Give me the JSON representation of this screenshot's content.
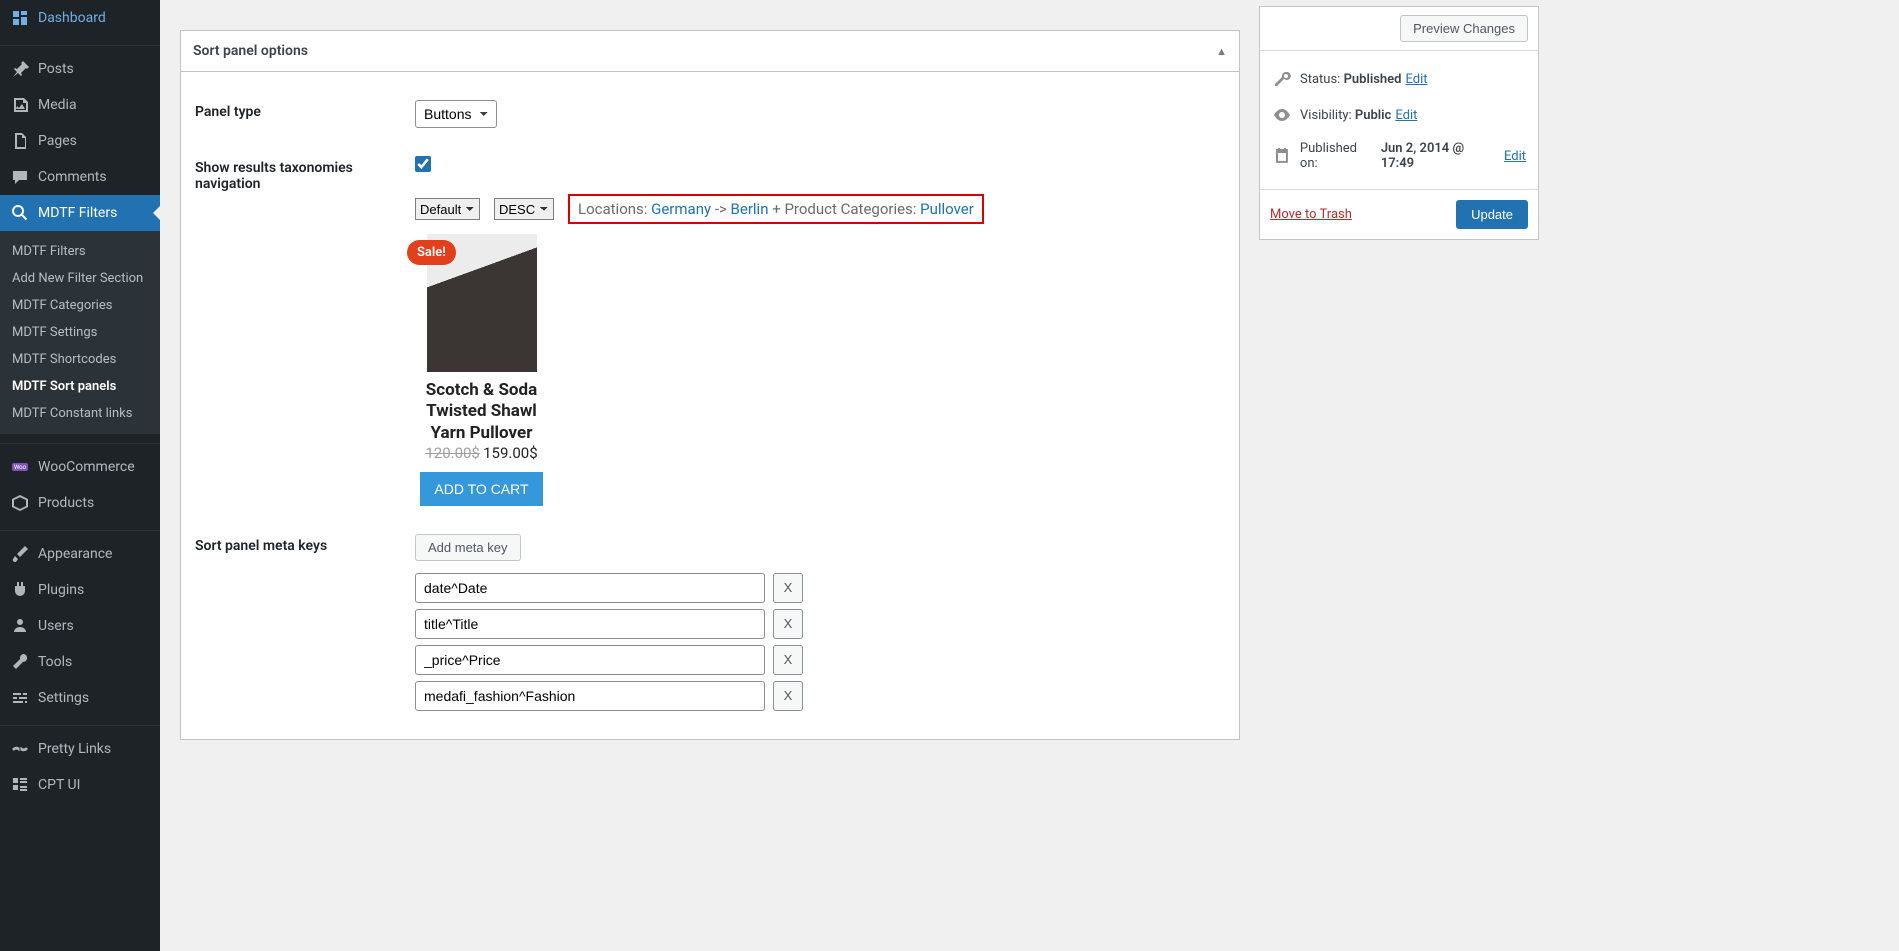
{
  "sidebar": {
    "items": [
      {
        "label": "Dashboard"
      },
      {
        "label": "Posts"
      },
      {
        "label": "Media"
      },
      {
        "label": "Pages"
      },
      {
        "label": "Comments"
      },
      {
        "label": "MDTF Filters"
      },
      {
        "label": "WooCommerce"
      },
      {
        "label": "Products"
      },
      {
        "label": "Appearance"
      },
      {
        "label": "Plugins"
      },
      {
        "label": "Users"
      },
      {
        "label": "Tools"
      },
      {
        "label": "Settings"
      },
      {
        "label": "Pretty Links"
      },
      {
        "label": "CPT UI"
      }
    ],
    "submenu": [
      {
        "label": "MDTF Filters"
      },
      {
        "label": "Add New Filter Section"
      },
      {
        "label": "MDTF Categories"
      },
      {
        "label": "MDTF Settings"
      },
      {
        "label": "MDTF Shortcodes"
      },
      {
        "label": "MDTF Sort panels"
      },
      {
        "label": "MDTF Constant links"
      }
    ]
  },
  "panel": {
    "title": "Sort panel options",
    "rows": {
      "panel_type": {
        "label": "Panel type",
        "value": "Buttons"
      },
      "show_tax": {
        "label": "Show results taxonomies navigation"
      },
      "meta_keys": {
        "label": "Sort panel meta keys",
        "add_btn": "Add meta key"
      }
    }
  },
  "preview": {
    "default_sel": "Default",
    "order_sel": "DESC",
    "breadcrumb": {
      "loc_label": "Locations: ",
      "country": "Germany",
      "arrow": " -> ",
      "city": "Berlin",
      "plus": " + Product Categories: ",
      "cat": "Pullover"
    },
    "product": {
      "sale": "Sale!",
      "title": "Scotch & Soda Twisted Shawl Yarn Pullover",
      "old_price": "120.00$",
      "new_price": "159.00$",
      "cart_btn": "ADD TO CART"
    }
  },
  "meta_items": [
    "date^Date",
    "title^Title",
    "_price^Price",
    "medafi_fashion^Fashion"
  ],
  "meta_x": "X",
  "publish": {
    "preview_btn": "Preview Changes",
    "status_label": "Status: ",
    "status_value": "Published",
    "visibility_label": "Visibility: ",
    "visibility_value": "Public",
    "published_label": "Published on: ",
    "published_value": "Jun 2, 2014 @ 17:49",
    "edit": "Edit",
    "trash": "Move to Trash",
    "update": "Update"
  }
}
